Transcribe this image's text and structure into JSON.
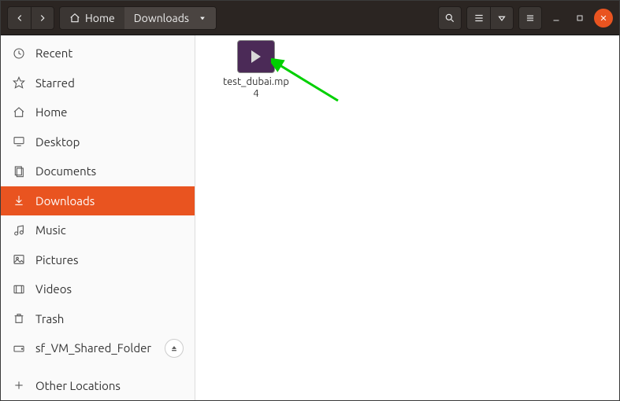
{
  "titlebar": {
    "path": {
      "home": "Home",
      "current": "Downloads"
    }
  },
  "sidebar": {
    "items": [
      {
        "id": "recent",
        "label": "Recent",
        "icon": "clock"
      },
      {
        "id": "starred",
        "label": "Starred",
        "icon": "star"
      },
      {
        "id": "home",
        "label": "Home",
        "icon": "home"
      },
      {
        "id": "desktop",
        "label": "Desktop",
        "icon": "desktop"
      },
      {
        "id": "documents",
        "label": "Documents",
        "icon": "documents"
      },
      {
        "id": "downloads",
        "label": "Downloads",
        "icon": "download",
        "active": true
      },
      {
        "id": "music",
        "label": "Music",
        "icon": "music"
      },
      {
        "id": "pictures",
        "label": "Pictures",
        "icon": "picture"
      },
      {
        "id": "videos",
        "label": "Videos",
        "icon": "video"
      },
      {
        "id": "trash",
        "label": "Trash",
        "icon": "trash"
      },
      {
        "id": "shared",
        "label": "sf_VM_Shared_Folder",
        "icon": "drive",
        "eject": true
      }
    ],
    "other_locations": "Other Locations"
  },
  "files": [
    {
      "name": "test_dubai.mp4",
      "type": "video"
    }
  ],
  "colors": {
    "accent": "#e95420",
    "header_bg": "#2b2522",
    "annotation": "#00d000"
  }
}
